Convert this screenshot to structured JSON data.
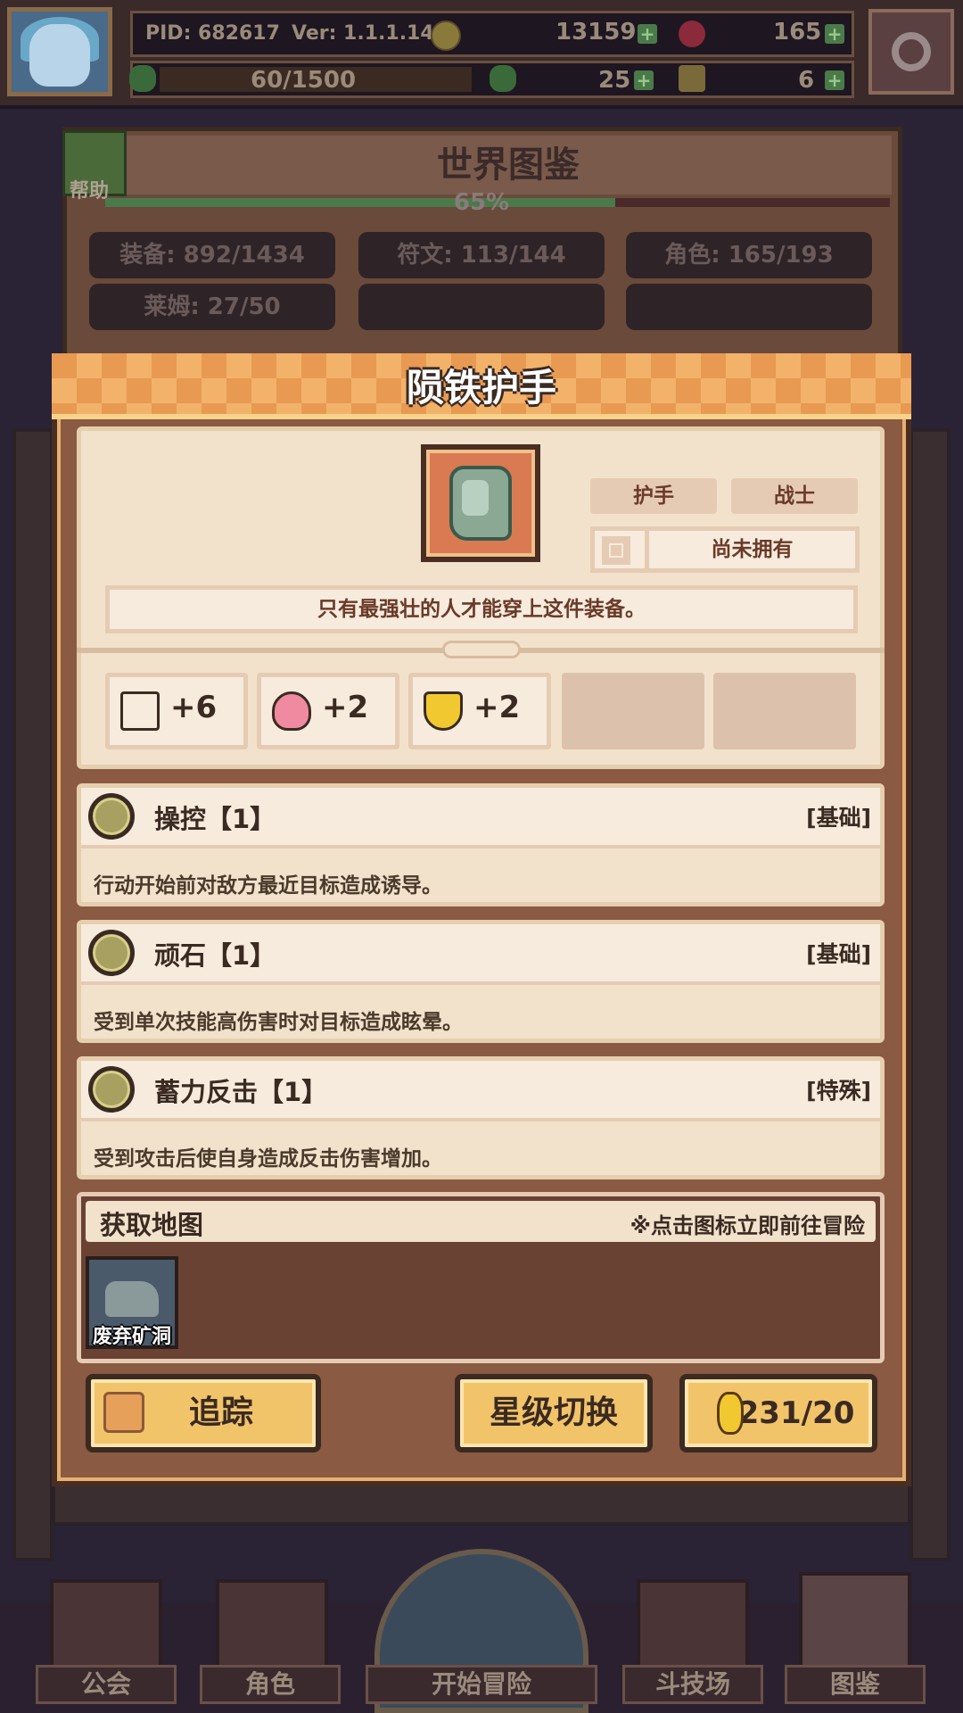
{
  "hud": {
    "pid": "PID: 682617",
    "version": "Ver: 1.1.1.14",
    "gold": "13159",
    "gems": "165",
    "energy": "60/1500",
    "clover": "25",
    "keys": "6"
  },
  "atlas": {
    "title": "世界图鉴",
    "help_label": "帮助",
    "percent": "65%",
    "progress": 0.65,
    "stats": [
      "装备: 892/1434",
      "符文: 113/144",
      "角色: 165/193",
      "莱姆: 27/50"
    ]
  },
  "item": {
    "name": "陨铁护手",
    "slot_tag": "护手",
    "class_tag": "战士",
    "owned_status": "尚未拥有",
    "description": "只有最强壮的人才能穿上这件装备。",
    "stats": [
      {
        "icon": "book-icon",
        "value": "+6"
      },
      {
        "icon": "heart-icon",
        "value": "+2"
      },
      {
        "icon": "shield-icon",
        "value": "+2"
      }
    ]
  },
  "skills": [
    {
      "name": "操控【1】",
      "type": "[基础]",
      "desc": "行动开始前对敌方最近目标造成诱导。"
    },
    {
      "name": "顽石【1】",
      "type": "[基础]",
      "desc": "受到单次技能高伤害时对目标造成眩晕。"
    },
    {
      "name": "蓄力反击【1】",
      "type": "[特殊]",
      "desc": "受到攻击后使自身造成反击伤害增加。"
    }
  ],
  "acquire": {
    "label": "获取地图",
    "hint": "※点击图标立即前往冒险",
    "maps": [
      "废弃矿洞"
    ]
  },
  "buttons": {
    "track": "追踪",
    "star_switch": "星级切换",
    "ore_count": "231/20"
  },
  "nav": [
    "公会",
    "角色",
    "开始冒险",
    "斗技场",
    "图鉴"
  ]
}
